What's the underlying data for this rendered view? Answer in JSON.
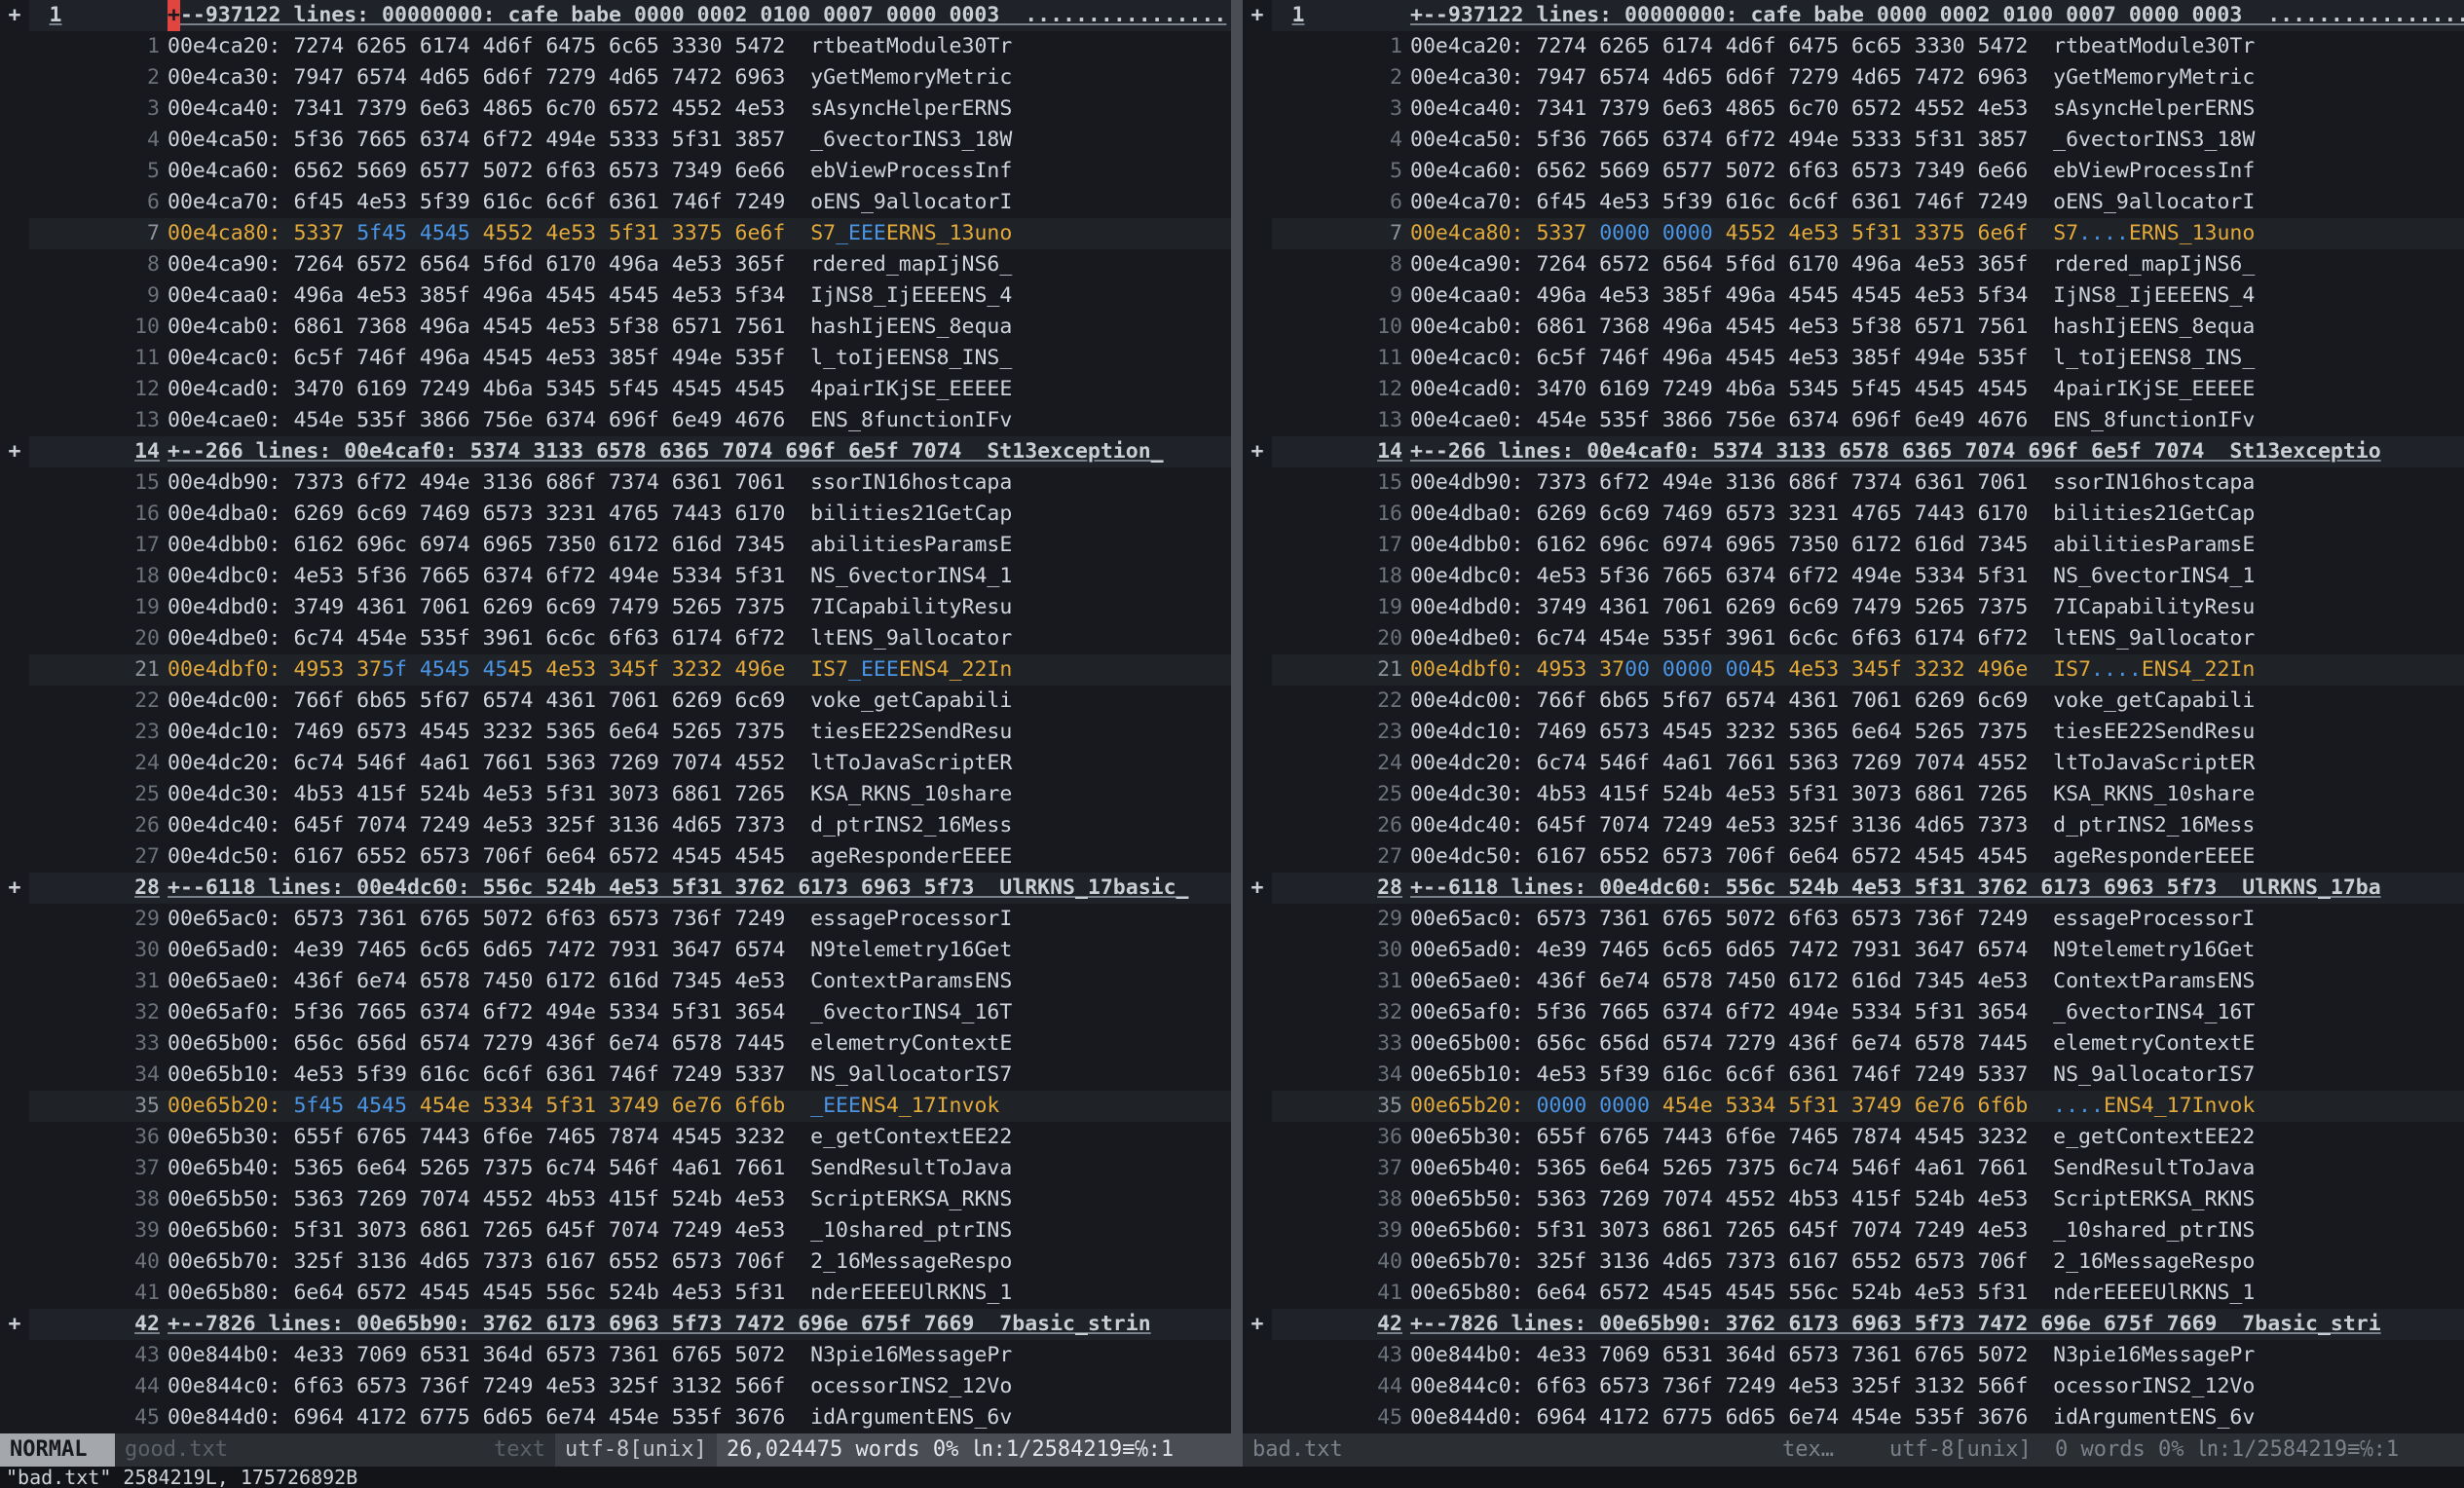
{
  "header": {
    "fold_summary": "+--937122 lines: 00000000: cafe babe 0000 0002 0100 0007 0000 0003  ................"
  },
  "left": {
    "lines": [
      {
        "n": "1",
        "addr": "00e4ca20:",
        "hex": "7274 6265 6174 4d6f 6475 6c65 3330 5472",
        "ascii": "rtbeatModule30Tr"
      },
      {
        "n": "2",
        "addr": "00e4ca30:",
        "hex": "7947 6574 4d65 6d6f 7279 4d65 7472 6963",
        "ascii": "yGetMemoryMetric"
      },
      {
        "n": "3",
        "addr": "00e4ca40:",
        "hex": "7341 7379 6e63 4865 6c70 6572 4552 4e53",
        "ascii": "sAsyncHelperERNS"
      },
      {
        "n": "4",
        "addr": "00e4ca50:",
        "hex": "5f36 7665 6374 6f72 494e 5333 5f31 3857",
        "ascii": "_6vectorINS3_18W"
      },
      {
        "n": "5",
        "addr": "00e4ca60:",
        "hex": "6562 5669 6577 5072 6f63 6573 7349 6e66",
        "ascii": "ebViewProcessInf"
      },
      {
        "n": "6",
        "addr": "00e4ca70:",
        "hex": "6f45 4e53 5f39 616c 6c6f 6361 746f 7249",
        "ascii": "oENS_9allocatorI"
      },
      {
        "n": "7",
        "addr": "00e4ca80:",
        "hex": "5337 5f45 4545 4552 4e53 5f31 3375 6e6f",
        "ascii": "S7_EEEERNS_13uno",
        "changed": true,
        "hex_parts": [
          [
            "s",
            "5337 "
          ],
          [
            "d",
            "5f45 4545"
          ],
          [
            "s",
            " 4552 4e53 5f31 3375 6e6f"
          ]
        ],
        "ascii_parts": [
          [
            "s",
            "S7"
          ],
          [
            "d",
            "_EEE"
          ],
          [
            "s",
            "ERNS_13uno"
          ]
        ]
      },
      {
        "n": "8",
        "addr": "00e4ca90:",
        "hex": "7264 6572 6564 5f6d 6170 496a 4e53 365f",
        "ascii": "rdered_mapIjNS6_"
      },
      {
        "n": "9",
        "addr": "00e4caa0:",
        "hex": "496a 4e53 385f 496a 4545 4545 4e53 5f34",
        "ascii": "IjNS8_IjEEEENS_4"
      },
      {
        "n": "10",
        "addr": "00e4cab0:",
        "hex": "6861 7368 496a 4545 4e53 5f38 6571 7561",
        "ascii": "hashIjEENS_8equa"
      },
      {
        "n": "11",
        "addr": "00e4cac0:",
        "hex": "6c5f 746f 496a 4545 4e53 385f 494e 535f",
        "ascii": "l_toIjEENS8_INS_"
      },
      {
        "n": "12",
        "addr": "00e4cad0:",
        "hex": "3470 6169 7249 4b6a 5345 5f45 4545 4545",
        "ascii": "4pairIKjSE_EEEEE"
      },
      {
        "n": "13",
        "addr": "00e4cae0:",
        "hex": "454e 535f 3866 756e 6374 696f 6e49 4676",
        "ascii": "ENS_8functionIFv"
      },
      {
        "n": "14",
        "fold": "+--266 lines: 00e4caf0: 5374 3133 6578 6365 7074 696f 6e5f 7074  St13exception_"
      },
      {
        "n": "15",
        "addr": "00e4db90:",
        "hex": "7373 6f72 494e 3136 686f 7374 6361 7061",
        "ascii": "ssorIN16hostcapa"
      },
      {
        "n": "16",
        "addr": "00e4dba0:",
        "hex": "6269 6c69 7469 6573 3231 4765 7443 6170",
        "ascii": "bilities21GetCap"
      },
      {
        "n": "17",
        "addr": "00e4dbb0:",
        "hex": "6162 696c 6974 6965 7350 6172 616d 7345",
        "ascii": "abilitiesParamsE"
      },
      {
        "n": "18",
        "addr": "00e4dbc0:",
        "hex": "4e53 5f36 7665 6374 6f72 494e 5334 5f31",
        "ascii": "NS_6vectorINS4_1"
      },
      {
        "n": "19",
        "addr": "00e4dbd0:",
        "hex": "3749 4361 7061 6269 6c69 7479 5265 7375",
        "ascii": "7ICapabilityResu"
      },
      {
        "n": "20",
        "addr": "00e4dbe0:",
        "hex": "6c74 454e 535f 3961 6c6c 6f63 6174 6f72",
        "ascii": "ltENS_9allocator"
      },
      {
        "n": "21",
        "addr": "00e4dbf0:",
        "hex": "4953 375f 4545 4545 4e53 345f 3232 496e",
        "ascii": "IS7_EEENS4_22In",
        "changed": true,
        "hex_parts": [
          [
            "s",
            "4953 37"
          ],
          [
            "d",
            "5f 4545 45"
          ],
          [
            "s",
            "45 4e53 345f 3232 496e"
          ]
        ],
        "ascii_parts": [
          [
            "s",
            "IS7"
          ],
          [
            "d",
            "_EEE"
          ],
          [
            "s",
            "ENS4_22In"
          ]
        ]
      },
      {
        "n": "22",
        "addr": "00e4dc00:",
        "hex": "766f 6b65 5f67 6574 4361 7061 6269 6c69",
        "ascii": "voke_getCapabili"
      },
      {
        "n": "23",
        "addr": "00e4dc10:",
        "hex": "7469 6573 4545 3232 5365 6e64 5265 7375",
        "ascii": "tiesEE22SendResu"
      },
      {
        "n": "24",
        "addr": "00e4dc20:",
        "hex": "6c74 546f 4a61 7661 5363 7269 7074 4552",
        "ascii": "ltToJavaScriptER"
      },
      {
        "n": "25",
        "addr": "00e4dc30:",
        "hex": "4b53 415f 524b 4e53 5f31 3073 6861 7265",
        "ascii": "KSA_RKNS_10share"
      },
      {
        "n": "26",
        "addr": "00e4dc40:",
        "hex": "645f 7074 7249 4e53 325f 3136 4d65 7373",
        "ascii": "d_ptrINS2_16Mess"
      },
      {
        "n": "27",
        "addr": "00e4dc50:",
        "hex": "6167 6552 6573 706f 6e64 6572 4545 4545",
        "ascii": "ageResponderEEEE"
      },
      {
        "n": "28",
        "fold": "+--6118 lines: 00e4dc60: 556c 524b 4e53 5f31 3762 6173 6963 5f73  UlRKNS_17basic_"
      },
      {
        "n": "29",
        "addr": "00e65ac0:",
        "hex": "6573 7361 6765 5072 6f63 6573 736f 7249",
        "ascii": "essageProcessorI"
      },
      {
        "n": "30",
        "addr": "00e65ad0:",
        "hex": "4e39 7465 6c65 6d65 7472 7931 3647 6574",
        "ascii": "N9telemetry16Get"
      },
      {
        "n": "31",
        "addr": "00e65ae0:",
        "hex": "436f 6e74 6578 7450 6172 616d 7345 4e53",
        "ascii": "ContextParamsENS"
      },
      {
        "n": "32",
        "addr": "00e65af0:",
        "hex": "5f36 7665 6374 6f72 494e 5334 5f31 3654",
        "ascii": "_6vectorINS4_16T"
      },
      {
        "n": "33",
        "addr": "00e65b00:",
        "hex": "656c 656d 6574 7279 436f 6e74 6578 7445",
        "ascii": "elemetryContextE"
      },
      {
        "n": "34",
        "addr": "00e65b10:",
        "hex": "4e53 5f39 616c 6c6f 6361 746f 7249 5337",
        "ascii": "NS_9allocatorIS7"
      },
      {
        "n": "35",
        "addr": "00e65b20:",
        "hex": "5f45 4545 454e 5334 5f31 3749 6e76 6f6b",
        "ascii": "_EEENS4_17Invok",
        "changed": true,
        "hex_parts": [
          [
            "d",
            "5f45 4545"
          ],
          [
            "s",
            " 454e 5334 5f31 3749 6e76 6f6b"
          ]
        ],
        "ascii_parts": [
          [
            "d",
            "_EEE"
          ],
          [
            "s",
            "NS4_17Invok"
          ]
        ]
      },
      {
        "n": "36",
        "addr": "00e65b30:",
        "hex": "655f 6765 7443 6f6e 7465 7874 4545 3232",
        "ascii": "e_getContextEE22"
      },
      {
        "n": "37",
        "addr": "00e65b40:",
        "hex": "5365 6e64 5265 7375 6c74 546f 4a61 7661",
        "ascii": "SendResultToJava"
      },
      {
        "n": "38",
        "addr": "00e65b50:",
        "hex": "5363 7269 7074 4552 4b53 415f 524b 4e53",
        "ascii": "ScriptERKSA_RKNS"
      },
      {
        "n": "39",
        "addr": "00e65b60:",
        "hex": "5f31 3073 6861 7265 645f 7074 7249 4e53",
        "ascii": "_10shared_ptrINS"
      },
      {
        "n": "40",
        "addr": "00e65b70:",
        "hex": "325f 3136 4d65 7373 6167 6552 6573 706f",
        "ascii": "2_16MessageRespo"
      },
      {
        "n": "41",
        "addr": "00e65b80:",
        "hex": "6e64 6572 4545 4545 556c 524b 4e53 5f31",
        "ascii": "nderEEEEUlRKNS_1"
      },
      {
        "n": "42",
        "fold": "+--7826 lines: 00e65b90: 3762 6173 6963 5f73 7472 696e 675f 7669  7basic_strin"
      },
      {
        "n": "43",
        "addr": "00e844b0:",
        "hex": "4e33 7069 6531 364d 6573 7361 6765 5072",
        "ascii": "N3pie16MessagePr"
      },
      {
        "n": "44",
        "addr": "00e844c0:",
        "hex": "6f63 6573 736f 7249 4e53 325f 3132 566f",
        "ascii": "ocessorINS2_12Vo"
      },
      {
        "n": "45",
        "addr": "00e844d0:",
        "hex": "6964 4172 6775 6d65 6e74 454e 535f 3676",
        "ascii": "idArgumentENS_6v"
      }
    ]
  },
  "right": {
    "lines": [
      {
        "n": "1",
        "addr": "00e4ca20:",
        "hex": "7274 6265 6174 4d6f 6475 6c65 3330 5472",
        "ascii": "rtbeatModule30Tr"
      },
      {
        "n": "2",
        "addr": "00e4ca30:",
        "hex": "7947 6574 4d65 6d6f 7279 4d65 7472 6963",
        "ascii": "yGetMemoryMetric"
      },
      {
        "n": "3",
        "addr": "00e4ca40:",
        "hex": "7341 7379 6e63 4865 6c70 6572 4552 4e53",
        "ascii": "sAsyncHelperERNS"
      },
      {
        "n": "4",
        "addr": "00e4ca50:",
        "hex": "5f36 7665 6374 6f72 494e 5333 5f31 3857",
        "ascii": "_6vectorINS3_18W"
      },
      {
        "n": "5",
        "addr": "00e4ca60:",
        "hex": "6562 5669 6577 5072 6f63 6573 7349 6e66",
        "ascii": "ebViewProcessInf"
      },
      {
        "n": "6",
        "addr": "00e4ca70:",
        "hex": "6f45 4e53 5f39 616c 6c6f 6361 746f 7249",
        "ascii": "oENS_9allocatorI"
      },
      {
        "n": "7",
        "addr": "00e4ca80:",
        "hex": "5337 0000 0000 4552 4e53 5f31 3375 6e6f",
        "ascii": "S7....ERNS_13uno",
        "changed": true,
        "hex_parts": [
          [
            "s",
            "5337 "
          ],
          [
            "d",
            "0000 0000"
          ],
          [
            "s",
            " 4552 4e53 5f31 3375 6e6f"
          ]
        ],
        "ascii_parts": [
          [
            "s",
            "S7"
          ],
          [
            "d",
            "...."
          ],
          [
            "s",
            "ERNS_13uno"
          ]
        ]
      },
      {
        "n": "8",
        "addr": "00e4ca90:",
        "hex": "7264 6572 6564 5f6d 6170 496a 4e53 365f",
        "ascii": "rdered_mapIjNS6_"
      },
      {
        "n": "9",
        "addr": "00e4caa0:",
        "hex": "496a 4e53 385f 496a 4545 4545 4e53 5f34",
        "ascii": "IjNS8_IjEEEENS_4"
      },
      {
        "n": "10",
        "addr": "00e4cab0:",
        "hex": "6861 7368 496a 4545 4e53 5f38 6571 7561",
        "ascii": "hashIjEENS_8equa"
      },
      {
        "n": "11",
        "addr": "00e4cac0:",
        "hex": "6c5f 746f 496a 4545 4e53 385f 494e 535f",
        "ascii": "l_toIjEENS8_INS_"
      },
      {
        "n": "12",
        "addr": "00e4cad0:",
        "hex": "3470 6169 7249 4b6a 5345 5f45 4545 4545",
        "ascii": "4pairIKjSE_EEEEE"
      },
      {
        "n": "13",
        "addr": "00e4cae0:",
        "hex": "454e 535f 3866 756e 6374 696f 6e49 4676",
        "ascii": "ENS_8functionIFv"
      },
      {
        "n": "14",
        "fold": "+--266 lines: 00e4caf0: 5374 3133 6578 6365 7074 696f 6e5f 7074  St13exceptio"
      },
      {
        "n": "15",
        "addr": "00e4db90:",
        "hex": "7373 6f72 494e 3136 686f 7374 6361 7061",
        "ascii": "ssorIN16hostcapa"
      },
      {
        "n": "16",
        "addr": "00e4dba0:",
        "hex": "6269 6c69 7469 6573 3231 4765 7443 6170",
        "ascii": "bilities21GetCap"
      },
      {
        "n": "17",
        "addr": "00e4dbb0:",
        "hex": "6162 696c 6974 6965 7350 6172 616d 7345",
        "ascii": "abilitiesParamsE"
      },
      {
        "n": "18",
        "addr": "00e4dbc0:",
        "hex": "4e53 5f36 7665 6374 6f72 494e 5334 5f31",
        "ascii": "NS_6vectorINS4_1"
      },
      {
        "n": "19",
        "addr": "00e4dbd0:",
        "hex": "3749 4361 7061 6269 6c69 7479 5265 7375",
        "ascii": "7ICapabilityResu"
      },
      {
        "n": "20",
        "addr": "00e4dbe0:",
        "hex": "6c74 454e 535f 3961 6c6c 6f63 6174 6f72",
        "ascii": "ltENS_9allocator"
      },
      {
        "n": "21",
        "addr": "00e4dbf0:",
        "hex": "4953 3700 0000 0045 4e53 345f 3232 496e",
        "ascii": "IS7....ENS4_22In",
        "changed": true,
        "hex_parts": [
          [
            "s",
            "4953 37"
          ],
          [
            "d",
            "00 0000 00"
          ],
          [
            "s",
            "45 4e53 345f 3232 496e"
          ]
        ],
        "ascii_parts": [
          [
            "s",
            "IS7"
          ],
          [
            "d",
            "...."
          ],
          [
            "s",
            "ENS4_22In"
          ]
        ]
      },
      {
        "n": "22",
        "addr": "00e4dc00:",
        "hex": "766f 6b65 5f67 6574 4361 7061 6269 6c69",
        "ascii": "voke_getCapabili"
      },
      {
        "n": "23",
        "addr": "00e4dc10:",
        "hex": "7469 6573 4545 3232 5365 6e64 5265 7375",
        "ascii": "tiesEE22SendResu"
      },
      {
        "n": "24",
        "addr": "00e4dc20:",
        "hex": "6c74 546f 4a61 7661 5363 7269 7074 4552",
        "ascii": "ltToJavaScriptER"
      },
      {
        "n": "25",
        "addr": "00e4dc30:",
        "hex": "4b53 415f 524b 4e53 5f31 3073 6861 7265",
        "ascii": "KSA_RKNS_10share"
      },
      {
        "n": "26",
        "addr": "00e4dc40:",
        "hex": "645f 7074 7249 4e53 325f 3136 4d65 7373",
        "ascii": "d_ptrINS2_16Mess"
      },
      {
        "n": "27",
        "addr": "00e4dc50:",
        "hex": "6167 6552 6573 706f 6e64 6572 4545 4545",
        "ascii": "ageResponderEEEE"
      },
      {
        "n": "28",
        "fold": "+--6118 lines: 00e4dc60: 556c 524b 4e53 5f31 3762 6173 6963 5f73  UlRKNS_17ba"
      },
      {
        "n": "29",
        "addr": "00e65ac0:",
        "hex": "6573 7361 6765 5072 6f63 6573 736f 7249",
        "ascii": "essageProcessorI"
      },
      {
        "n": "30",
        "addr": "00e65ad0:",
        "hex": "4e39 7465 6c65 6d65 7472 7931 3647 6574",
        "ascii": "N9telemetry16Get"
      },
      {
        "n": "31",
        "addr": "00e65ae0:",
        "hex": "436f 6e74 6578 7450 6172 616d 7345 4e53",
        "ascii": "ContextParamsENS"
      },
      {
        "n": "32",
        "addr": "00e65af0:",
        "hex": "5f36 7665 6374 6f72 494e 5334 5f31 3654",
        "ascii": "_6vectorINS4_16T"
      },
      {
        "n": "33",
        "addr": "00e65b00:",
        "hex": "656c 656d 6574 7279 436f 6e74 6578 7445",
        "ascii": "elemetryContextE"
      },
      {
        "n": "34",
        "addr": "00e65b10:",
        "hex": "4e53 5f39 616c 6c6f 6361 746f 7249 5337",
        "ascii": "NS_9allocatorIS7"
      },
      {
        "n": "35",
        "addr": "00e65b20:",
        "hex": "0000 0000 454e 5334 5f31 3749 6e76 6f6b",
        "ascii": "....ENS4_17Invok",
        "changed": true,
        "hex_parts": [
          [
            "d",
            "0000 0000"
          ],
          [
            "s",
            " 454e 5334 5f31 3749 6e76 6f6b"
          ]
        ],
        "ascii_parts": [
          [
            "d",
            "...."
          ],
          [
            "s",
            "ENS4_17Invok"
          ]
        ]
      },
      {
        "n": "36",
        "addr": "00e65b30:",
        "hex": "655f 6765 7443 6f6e 7465 7874 4545 3232",
        "ascii": "e_getContextEE22"
      },
      {
        "n": "37",
        "addr": "00e65b40:",
        "hex": "5365 6e64 5265 7375 6c74 546f 4a61 7661",
        "ascii": "SendResultToJava"
      },
      {
        "n": "38",
        "addr": "00e65b50:",
        "hex": "5363 7269 7074 4552 4b53 415f 524b 4e53",
        "ascii": "ScriptERKSA_RKNS"
      },
      {
        "n": "39",
        "addr": "00e65b60:",
        "hex": "5f31 3073 6861 7265 645f 7074 7249 4e53",
        "ascii": "_10shared_ptrINS"
      },
      {
        "n": "40",
        "addr": "00e65b70:",
        "hex": "325f 3136 4d65 7373 6167 6552 6573 706f",
        "ascii": "2_16MessageRespo"
      },
      {
        "n": "41",
        "addr": "00e65b80:",
        "hex": "6e64 6572 4545 4545 556c 524b 4e53 5f31",
        "ascii": "nderEEEEUlRKNS_1"
      },
      {
        "n": "42",
        "fold": "+--7826 lines: 00e65b90: 3762 6173 6963 5f73 7472 696e 675f 7669  7basic_stri"
      },
      {
        "n": "43",
        "addr": "00e844b0:",
        "hex": "4e33 7069 6531 364d 6573 7361 6765 5072",
        "ascii": "N3pie16MessagePr"
      },
      {
        "n": "44",
        "addr": "00e844c0:",
        "hex": "6f63 6573 736f 7249 4e53 325f 3132 566f",
        "ascii": "ocessorINS2_12Vo"
      },
      {
        "n": "45",
        "addr": "00e844d0:",
        "hex": "6964 4172 6775 6d65 6e74 454e 535f 3676",
        "ascii": "idArgumentENS_6v"
      }
    ]
  },
  "first_line_number": "1",
  "fold_marker": "+",
  "status": {
    "mode": "NORMAL",
    "left_file": "good.txt",
    "left_filetype": "text",
    "left_encoding": "utf-8[unix]",
    "left_info": "26,024475 words 0% ㏑:1/2584219≡℅:1",
    "right_file": "bad.txt",
    "right_filetype": "tex…",
    "right_encoding": "utf-8[unix]",
    "right_info": "0 words 0% ㏑:1/2584219≡℅:1"
  },
  "cmdline": "\"bad.txt\" 2584219L, 175726892B",
  "colors": {
    "changed_same": "#e2a93b",
    "changed_diff": "#4a95e6",
    "cursor": "#e0463f"
  }
}
